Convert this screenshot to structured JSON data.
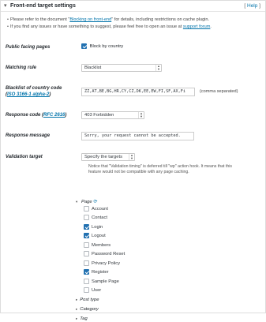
{
  "header": {
    "title": "Front-end target settings",
    "help_open": "[ ",
    "help_link": "Help",
    "help_close": " ]"
  },
  "notes": [
    {
      "pre": "Please refer to the document \"",
      "link": "Blocking on front-end",
      "post": "\" for details, including restrictions on cache plugin."
    },
    {
      "pre": "If you find any issues or have something to suggest, please feel free to open an issue at ",
      "link": "support forum",
      "post": "."
    }
  ],
  "public_facing": {
    "label": "Public facing pages",
    "checkbox_label": "Block by country",
    "checked": true
  },
  "matching_rule": {
    "label": "Matching rule",
    "value": "Blacklist"
  },
  "blacklist": {
    "label_line1": "Blacklist of country code",
    "label_open": "(",
    "label_link": "ISO 3166-1 alpha-2",
    "label_close": ")",
    "value": "ZZ,AT,BE,BG,HR,CY,CZ,DK,EE,EW,FI,SF,AX,Fi",
    "hint": "(comma separated)"
  },
  "response_code": {
    "label_pre": "Response code (",
    "label_link": "RFC 2616",
    "label_post": ")",
    "value": "403 Forbidden"
  },
  "response_message": {
    "label": "Response message",
    "value": "Sorry, your request cannot be accepted."
  },
  "validation_target": {
    "label": "Validation target",
    "value": "Specify the targets",
    "desc_line1": "Notice that \"Validation timing\" is deferred till \"wp\" action hook. It means that this",
    "desc_line2": "feature would not be compatible with any page caching."
  },
  "page_tree": {
    "label": "Page",
    "items": [
      {
        "label": "Account",
        "checked": false
      },
      {
        "label": "Contact",
        "checked": false
      },
      {
        "label": "Login",
        "checked": true
      },
      {
        "label": "Logout",
        "checked": true
      },
      {
        "label": "Members",
        "checked": false
      },
      {
        "label": "Password Reset",
        "checked": false
      },
      {
        "label": "Privacy Policy",
        "checked": false
      },
      {
        "label": "Register",
        "checked": true
      },
      {
        "label": "Sample Page",
        "checked": false
      },
      {
        "label": "User",
        "checked": false
      }
    ]
  },
  "collapsed_groups": [
    "Post type",
    "Category",
    "Tag"
  ],
  "colors": {
    "link": "#0073aa",
    "checkbox_checked": "#2271b1"
  }
}
